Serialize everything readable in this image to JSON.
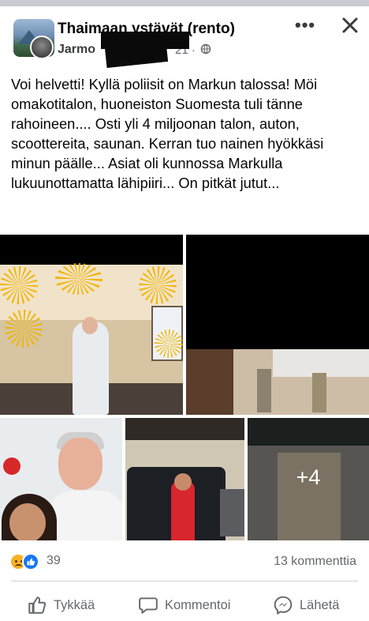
{
  "post": {
    "group_name": "Thaimaan ystävät (rento)",
    "author": "Jarmo",
    "time": "21 ·",
    "text": "Voi helvetti! Kyllä poliisit on Markun talossa! Möi omakotitalon, huoneiston Suomesta tuli tänne rahoineen.... Osti yli 4 miljoonan talon, auton, scoottereita, saunan. Kerran tuo nainen hyökkäsi minun päälle... Asiat oli kunnossa Markulla lukuunottamatta lähipiiri... On pitkät jutut...",
    "more_photos": "+4"
  },
  "stats": {
    "reaction_count": "39",
    "comments": "13 kommenttia"
  },
  "actions": {
    "like": "Tykkää",
    "comment": "Kommentoi",
    "share": "Lähetä"
  },
  "icons": {
    "more": "more-dots-icon",
    "close": "close-icon",
    "privacy": "globe-icon",
    "reaction_sad": "sad-reaction-icon",
    "reaction_like": "like-reaction-icon"
  },
  "colors": {
    "brand_blue": "#1877f2",
    "secondary_text": "#65676b",
    "primary_text": "#050505"
  }
}
